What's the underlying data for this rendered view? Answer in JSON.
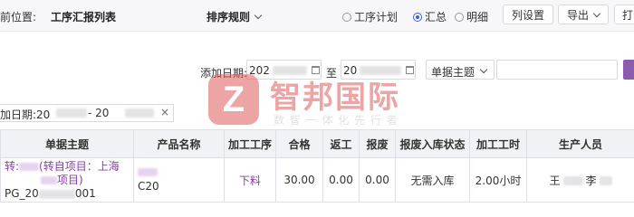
{
  "header": {
    "position_label": "前位置:",
    "page_title": "工序汇报列表",
    "sort_label": "排序规则",
    "view_options": [
      {
        "label": "工序计划",
        "checked": false
      },
      {
        "label": "汇总",
        "checked": true
      },
      {
        "label": "明细",
        "checked": false
      }
    ],
    "column_settings_label": "列设置",
    "export_label": "导出",
    "print_label": "打"
  },
  "filter": {
    "add_date_label": "添加日期:",
    "date_from_prefix": "202",
    "to_label": "至",
    "date_to_prefix": "20",
    "doc_subject_label": "单据主题"
  },
  "active_filter": {
    "prefix": "加日期:20",
    "separator": "- 20",
    "remove": "×"
  },
  "table": {
    "headers": [
      "单据主题",
      "产品名称",
      "加工工序",
      "合格",
      "返工",
      "报废",
      "报废入库状态",
      "加工工时",
      "生产人员"
    ],
    "rows": [
      {
        "subject_line1": "转:",
        "subject_line1b": "(转自项目：上海",
        "subject_line2": "项目)",
        "doc_no_prefix": "PG_20",
        "doc_no_suffix": "001",
        "product": "C20",
        "process": "下料",
        "qualified": "30.00",
        "rework": "0.00",
        "scrap": "0.00",
        "scrap_status": "无需入库",
        "hours": "2.00小时",
        "worker_a": "王",
        "worker_b": "李"
      }
    ]
  },
  "watermark": {
    "logo_glyph": "Z",
    "name": "智邦国际",
    "slogan": "数 智 一 体 化 先 行 者"
  },
  "colors": {
    "accent": "#3a63d8",
    "link_purple": "#8b3fa8",
    "watermark_red": "#e05a5a",
    "header_bg": "#f7f7f9"
  }
}
